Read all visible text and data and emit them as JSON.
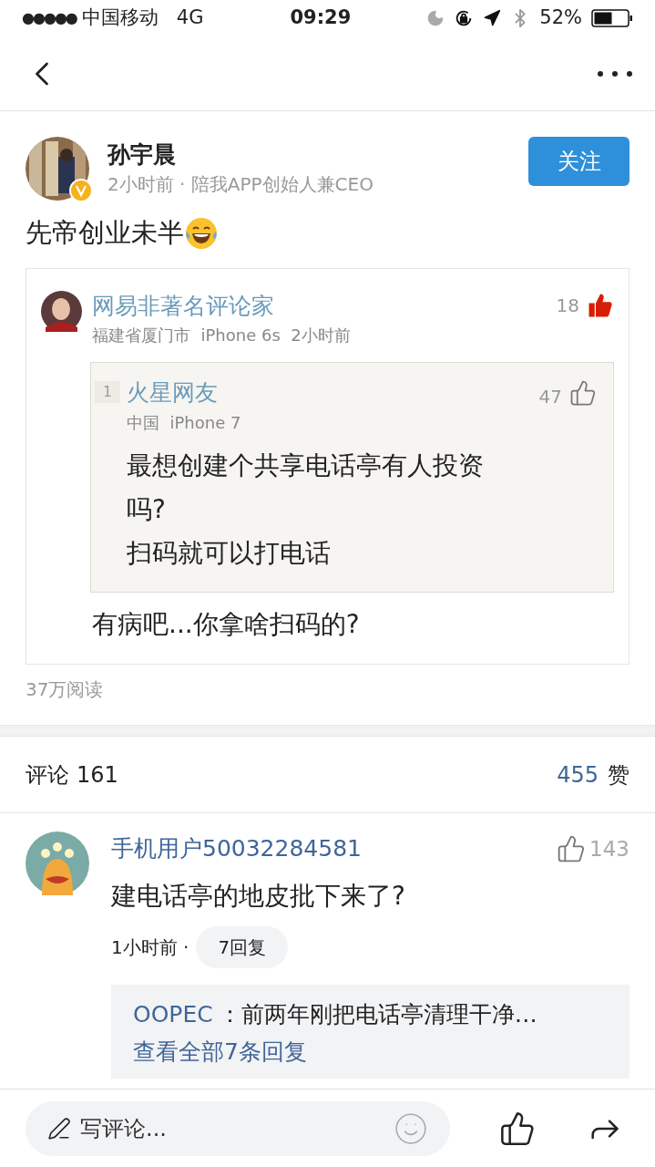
{
  "status_bar": {
    "signal": "●●●●●",
    "carrier": "中国移动",
    "network": "4G",
    "time": "09:29",
    "battery": "52%"
  },
  "post": {
    "author": "孙宇晨",
    "verified": true,
    "meta": "2小时前 · 陪我APP创始人兼CEO",
    "follow_button": "关注",
    "text": "先帝创业未半",
    "quote": {
      "author": "网易非著名评论家",
      "meta": "福建省厦门市  iPhone 6s  2小时前",
      "likes": "18",
      "liked": true,
      "nested": {
        "index": "1",
        "author": "火星网友",
        "meta": "中国  iPhone 7",
        "likes": "47",
        "liked": false,
        "lines": [
          "最想创建个共享电话亭有人投资",
          "吗?",
          "扫码就可以打电话"
        ]
      },
      "reply": "有病吧...你拿啥扫码的?"
    },
    "reads": "37万阅读"
  },
  "comments_header": {
    "label": "评论",
    "count": "161",
    "likes": "455",
    "likes_label": "赞"
  },
  "comments": [
    {
      "author": "手机用户50032284581",
      "likes": "143",
      "liked": false,
      "text": "建电话亭的地皮批下来了?",
      "time": "1小时前 ·",
      "replies_button": "7回复",
      "replies_preview": {
        "author": "OOPEC",
        "text": "：前两年刚把电话亭清理干净…",
        "more": "查看全部7条回复"
      }
    }
  ],
  "bottom_bar": {
    "placeholder": "写评论..."
  }
}
